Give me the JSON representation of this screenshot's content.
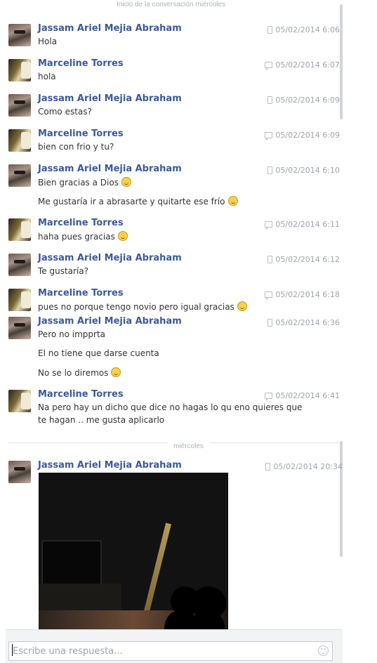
{
  "conversation": {
    "start_label": "Inicio de la conversación miércoles",
    "divider_label": "miércoles"
  },
  "messages": [
    {
      "sender": "Jassam Ariel Mejia Abraham",
      "time": "05/02/2014 6:06",
      "source": "phone-icon",
      "lines": [
        "Hola"
      ]
    },
    {
      "sender": "Marceline Torres",
      "time": "05/02/2014 6:07",
      "source": "chat-icon",
      "lines": [
        "hola"
      ]
    },
    {
      "sender": "Jassam Ariel Mejia Abraham",
      "time": "05/02/2014 6:09",
      "source": "phone-icon",
      "lines": [
        "Como estas?"
      ]
    },
    {
      "sender": "Marceline Torres",
      "time": "05/02/2014 6:09",
      "source": "chat-icon",
      "lines": [
        "bien con frio y tu?"
      ]
    },
    {
      "sender": "Jassam Ariel Mejia Abraham",
      "time": "05/02/2014 6:10",
      "source": "phone-icon",
      "lines": [
        "Bien gracias a Dios",
        "Me gustaría ir a abrasarte y quitarte ese frío"
      ]
    },
    {
      "sender": "Marceline Torres",
      "time": "05/02/2014 6:11",
      "source": "chat-icon",
      "lines": [
        "haha pues gracias"
      ]
    },
    {
      "sender": "Jassam Ariel Mejia Abraham",
      "time": "05/02/2014 6:12",
      "source": "phone-icon",
      "lines": [
        "Te gustaría?"
      ]
    },
    {
      "sender": "Marceline Torres",
      "time": "05/02/2014 6:18",
      "source": "chat-icon",
      "lines": [
        "pues no porque tengo novio pero igual gracias"
      ]
    },
    {
      "sender": "Jassam Ariel Mejia Abraham",
      "time": "05/02/2014 6:36",
      "source": "phone-icon",
      "lines": [
        "Pero no impprta",
        "El no tiene que darse cuenta",
        "No se lo diremos"
      ]
    },
    {
      "sender": "Marceline Torres",
      "time": "05/02/2014 6:41",
      "source": "chat-icon",
      "lines": [
        "Na pero hay un dicho que dice no hagas lo qu eno quieres que te hagan .. me gusta aplicarlo"
      ]
    },
    {
      "sender": "Jassam Ariel Mejia Abraham",
      "time": "05/02/2014 20:34",
      "source": "phone-icon",
      "lines": []
    }
  ],
  "composer": {
    "placeholder": "Escribe una respuesta...",
    "emoji_icon": "smiley-icon"
  }
}
